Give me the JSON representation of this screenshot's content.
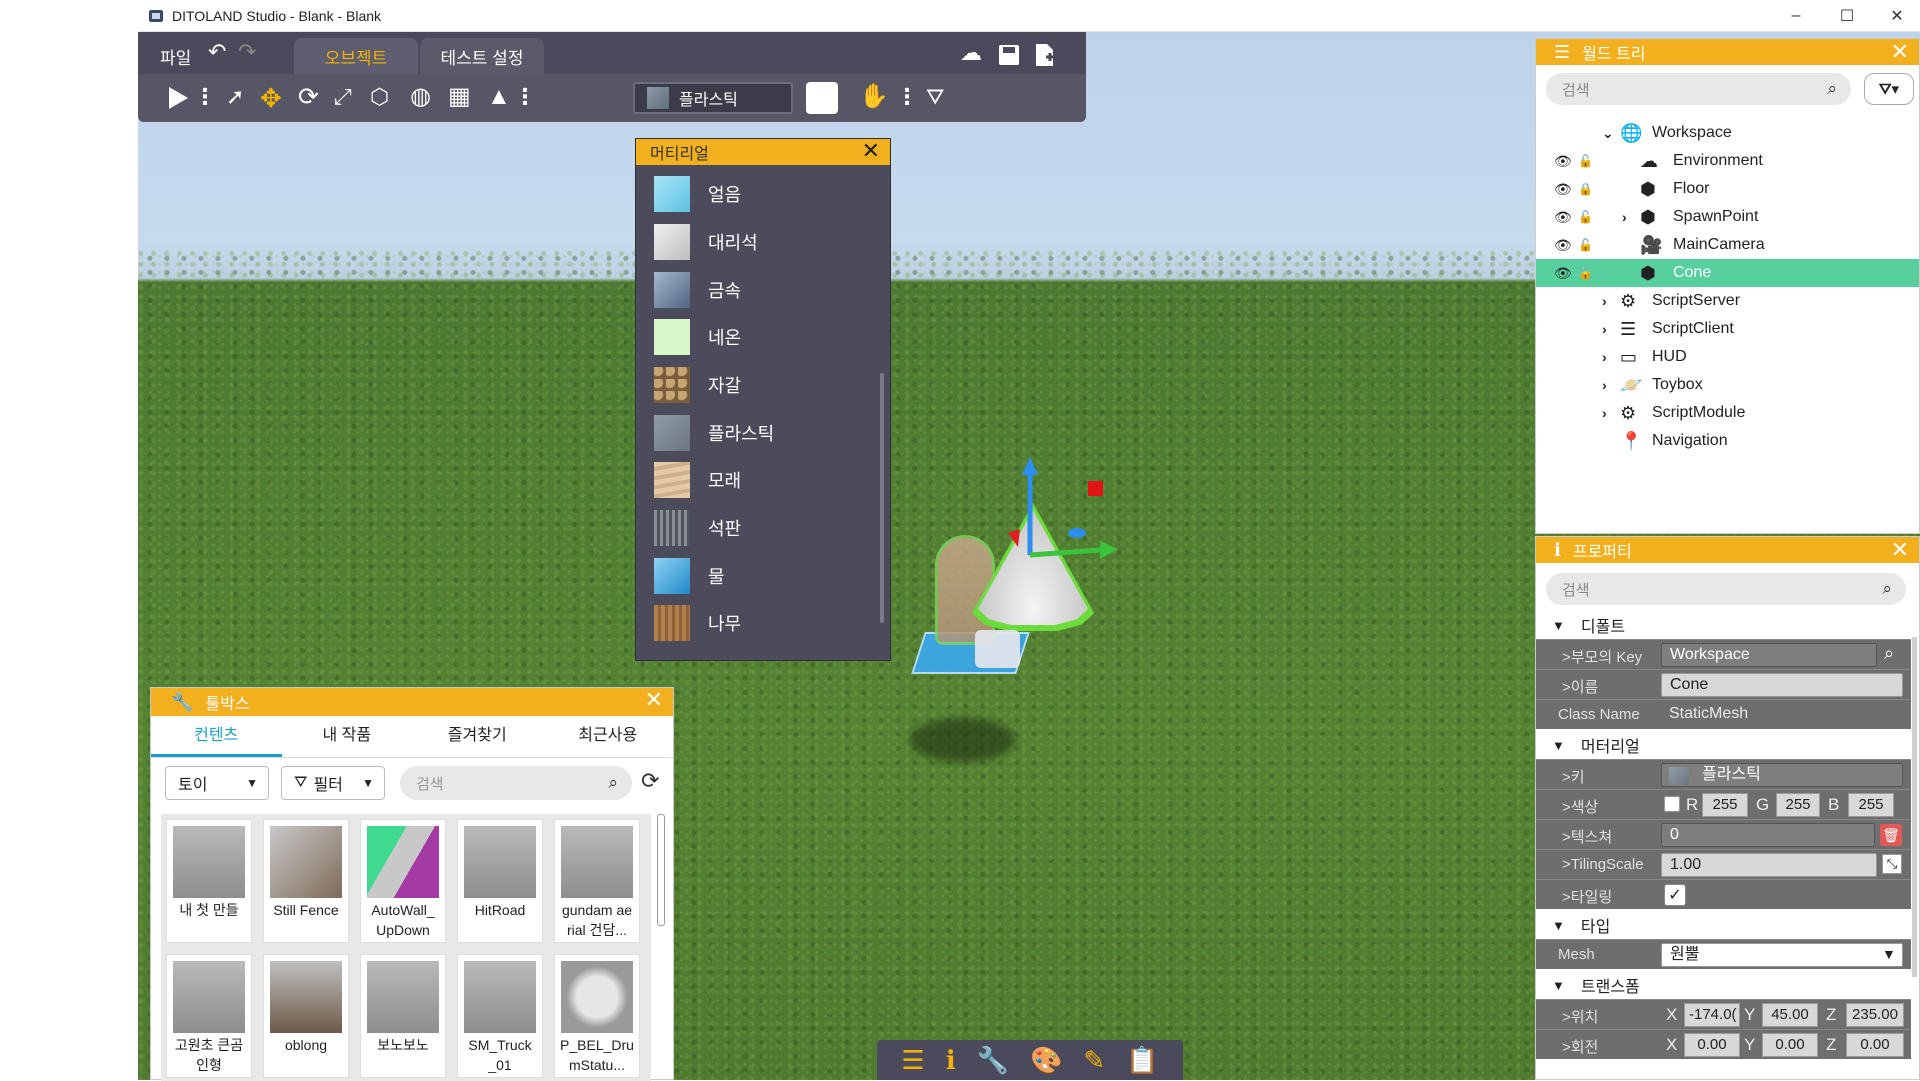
{
  "window": {
    "title": "DITOLAND Studio - Blank - Blank",
    "minimize": "–",
    "maximize": "☐",
    "close": "✕"
  },
  "toolbar": {
    "menu_file": "파일",
    "tabs": [
      {
        "label": "오브젝트",
        "active": true
      },
      {
        "label": "테스트 설정",
        "active": false
      }
    ],
    "material_select": "플라스틱"
  },
  "material_panel": {
    "title": "머티리얼",
    "items": [
      {
        "label": "얼음",
        "color": "#7fd3ee"
      },
      {
        "label": "대리석",
        "color": "#dcdcdc"
      },
      {
        "label": "금속",
        "color": "#7a8fa8"
      },
      {
        "label": "네온",
        "color": "#d8f7c8"
      },
      {
        "label": "자갈",
        "color": "#9b7d52"
      },
      {
        "label": "플라스틱",
        "color": "#7d8893"
      },
      {
        "label": "모래",
        "color": "#d9bf9c"
      },
      {
        "label": "석판",
        "color": "#6c7078"
      },
      {
        "label": "물",
        "color": "#3aa0dc"
      },
      {
        "label": "나무",
        "color": "#a6784a"
      }
    ]
  },
  "toolbox": {
    "title": "툴박스",
    "tabs": [
      {
        "label": "컨텐츠",
        "active": true
      },
      {
        "label": "내 작품"
      },
      {
        "label": "즐겨찾기"
      },
      {
        "label": "최근사용"
      }
    ],
    "category": "토이",
    "filter": "필터",
    "search_placeholder": "검색",
    "items": [
      {
        "name": "내 첫 만들"
      },
      {
        "name": "Still Fence"
      },
      {
        "name": "AutoWall_ UpDown"
      },
      {
        "name": "HitRoad"
      },
      {
        "name": "gundam ae rial 건담..."
      },
      {
        "name": "고원초 큰곰 인형"
      },
      {
        "name": "oblong"
      },
      {
        "name": "보노보노"
      },
      {
        "name": "SM_Truck _01"
      },
      {
        "name": "P_BEL_Dru mStatu..."
      }
    ]
  },
  "worldtree": {
    "title": "월드 트리",
    "search_placeholder": "검색",
    "items": [
      {
        "label": "Workspace",
        "icon": "workspace-icon"
      },
      {
        "label": "Environment",
        "icon": "environment-icon"
      },
      {
        "label": "Floor",
        "icon": "cube-icon"
      },
      {
        "label": "SpawnPoint",
        "icon": "cube-icon"
      },
      {
        "label": "MainCamera",
        "icon": "camera-icon"
      },
      {
        "label": "Cone",
        "icon": "cube-icon"
      },
      {
        "label": "ScriptServer",
        "icon": "script-server-icon"
      },
      {
        "label": "ScriptClient",
        "icon": "script-client-icon"
      },
      {
        "label": "HUD",
        "icon": "hud-icon"
      },
      {
        "label": "Toybox",
        "icon": "toybox-icon"
      },
      {
        "label": "ScriptModule",
        "icon": "script-module-icon"
      },
      {
        "label": "Navigation",
        "icon": "navigation-icon"
      }
    ]
  },
  "properties": {
    "title": "프로퍼티",
    "search_placeholder": "검색",
    "sections": {
      "default": "디폴트",
      "material": "머터리얼",
      "type": "타입",
      "transform": "트랜스폼"
    },
    "parent_key_label": ">부모의 Key",
    "parent_key": "Workspace",
    "name_label": ">이름",
    "name": "Cone",
    "classname_label": "Class Name",
    "classname": "StaticMesh",
    "key_label": ">키",
    "key_value": "플라스틱",
    "color_label": ">색상",
    "color_r_label": "R",
    "color_r": "255",
    "color_g_label": "G",
    "color_g": "255",
    "color_b_label": "B",
    "color_b": "255",
    "texture_label": ">텍스쳐",
    "texture": "0",
    "tiling_scale_label": ">TilingScale",
    "tiling_scale": "1.00",
    "tiling_label": ">타일링",
    "mesh_label": "Mesh",
    "mesh": "원뿔",
    "position_label": ">위치",
    "pos_x_label": "X",
    "pos_x": "-174.0(",
    "pos_y_label": "Y",
    "pos_y": "45.00",
    "pos_z_label": "Z",
    "pos_z": "235.00",
    "rotation_label": ">회전",
    "rot_x_label": "X",
    "rot_x": "0.00",
    "rot_y_label": "Y",
    "rot_y": "0.00",
    "rot_z_label": "Z",
    "rot_z": "0.00"
  },
  "colors": {
    "accent": "#f2b01e",
    "selection": "#58cf9f",
    "active_tab": "#1aa0c9"
  }
}
